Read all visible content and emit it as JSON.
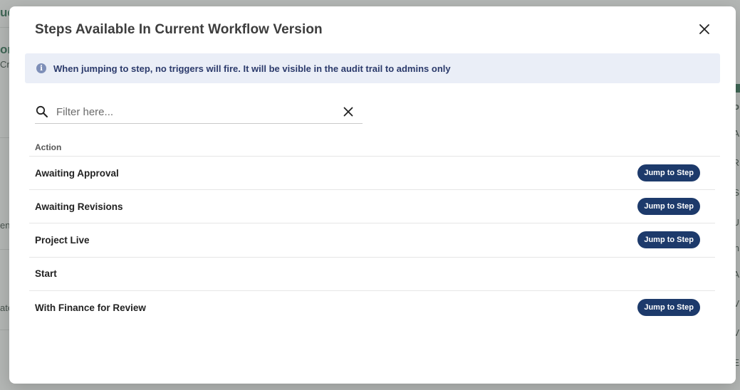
{
  "background": {
    "fragments": [
      "ud",
      "on",
      "Cra",
      "ent",
      "ate"
    ],
    "right_letters": [
      "A",
      "R",
      "S",
      "U",
      "n",
      "A",
      "V",
      "V",
      "E"
    ]
  },
  "modal": {
    "title": "Steps Available In Current Workflow Version",
    "close_icon": "close-icon",
    "info": {
      "icon": "info-icon",
      "glyph": "i",
      "text": "When jumping to step, no triggers will fire. It will be visible in the audit trail to admins only"
    },
    "filter": {
      "placeholder": "Filter here...",
      "value": ""
    },
    "table": {
      "column_header": "Action",
      "rows": [
        {
          "label": "Awaiting Approval",
          "button": "Jump to Step"
        },
        {
          "label": "Awaiting Revisions",
          "button": "Jump to Step"
        },
        {
          "label": "Project Live",
          "button": "Jump to Step"
        },
        {
          "label": "Start",
          "button": null
        },
        {
          "label": "With Finance for Review",
          "button": "Jump to Step"
        }
      ]
    }
  },
  "colors": {
    "button": "#1d3a6b",
    "banner_bg": "#eaeef7",
    "banner_text": "#2b3a6b",
    "accent_green": "#2c6b52"
  }
}
